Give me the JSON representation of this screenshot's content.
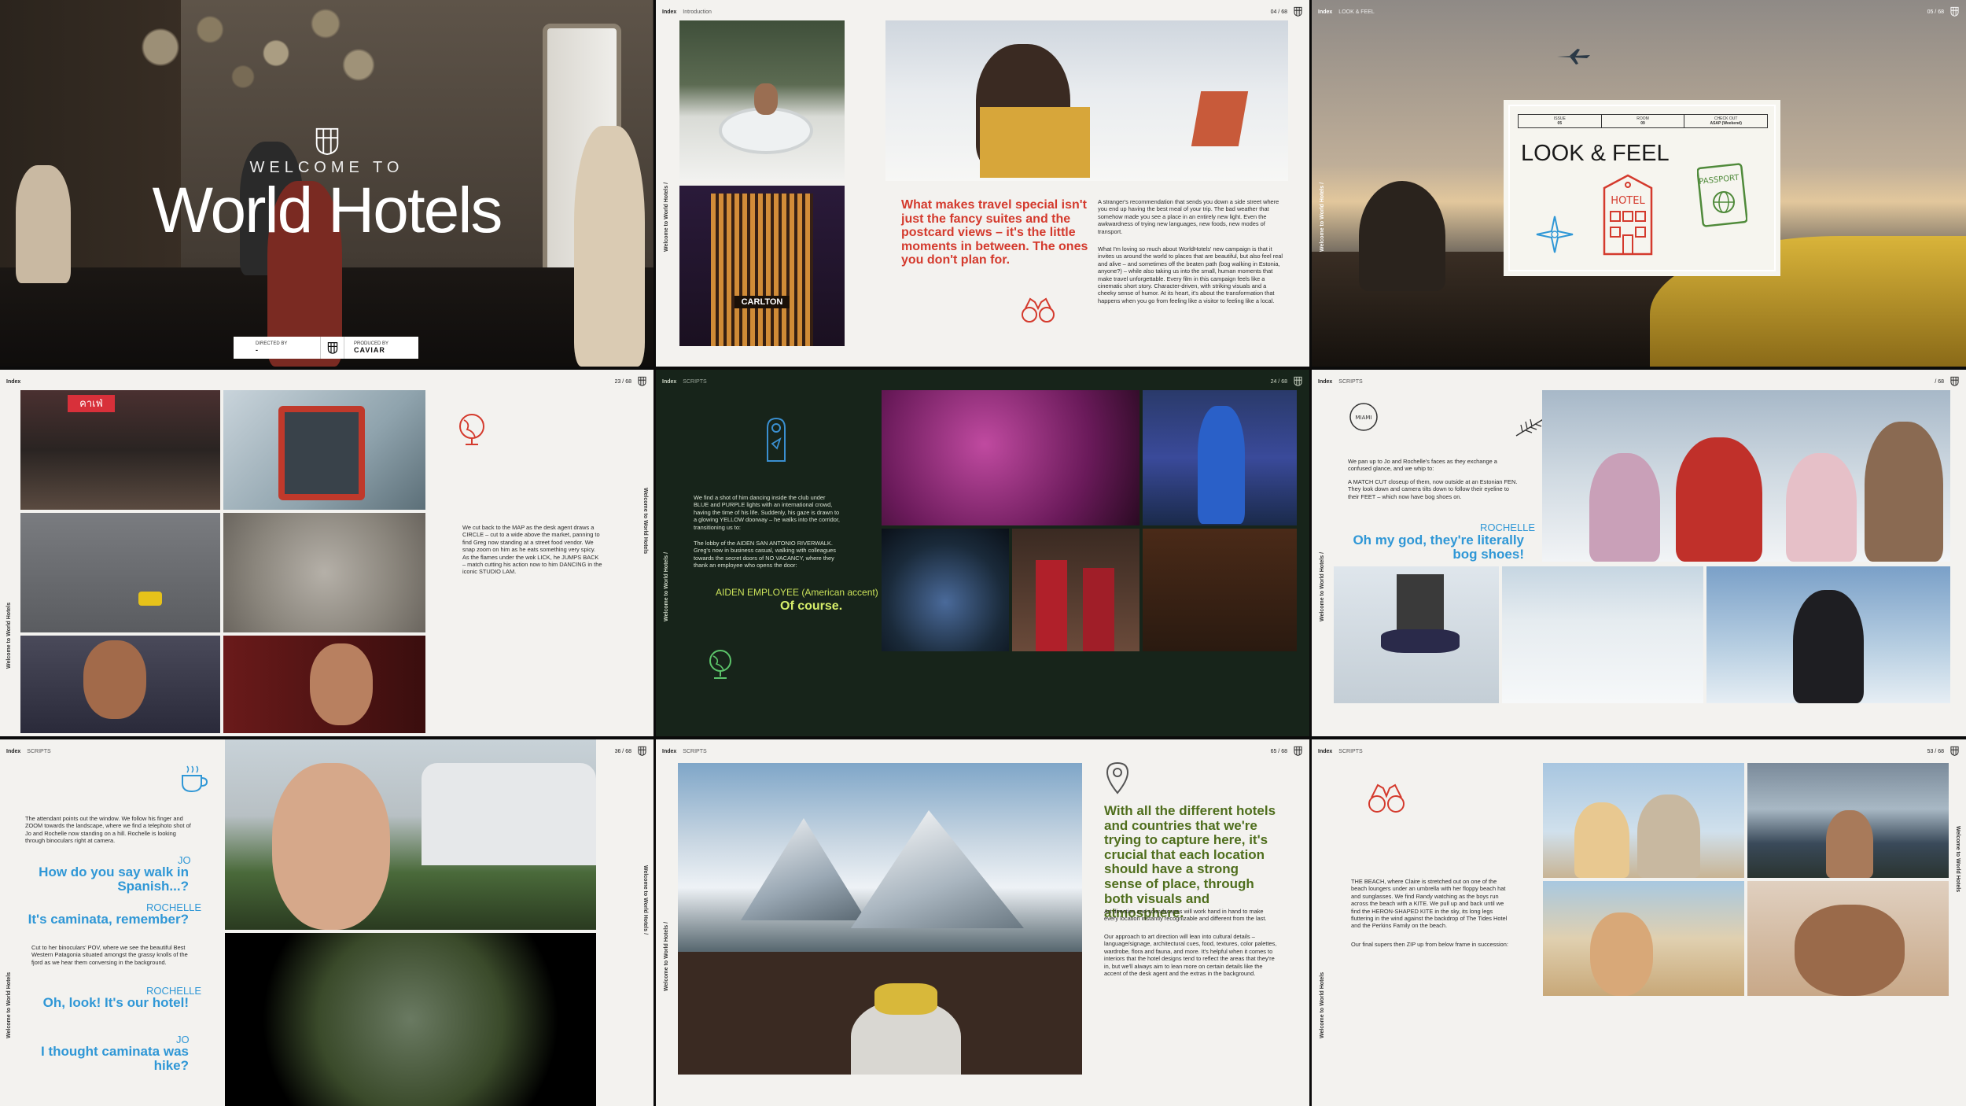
{
  "slides": {
    "s1": {
      "welcome": "WELCOME TO",
      "title": "World Hotels",
      "directed_label": "DIRECTED BY",
      "directed_value": "-",
      "produced_label": "PRODUCED BY",
      "produced_value": "CAVIAR"
    },
    "s2": {
      "index": "Index",
      "section": "Introduction",
      "page": "04 / 68",
      "side": "Welcome to World Hotels /",
      "sign": "CARLTON",
      "headline": "What makes travel special isn't just the fancy suites and the postcard views – it's the little moments in between. The ones you don't plan for.",
      "para1": "A stranger's recommendation that sends you down a side street where you end up having the best meal of your trip. The bad weather that somehow made you see a place in an entirely new light. Even the awkwardness of trying new languages, new foods, new modes of transport.",
      "para2": "What I'm loving so much about WorldHotels' new campaign is that it invites us around the world to places that are beautiful, but also feel real and alive – and sometimes off the beaten path (bog walking in Estonia, anyone?) – while also taking us into the small, human moments that make travel unforgettable. Every film in this campaign feels like a cinematic short story. Character-driven, with striking visuals and a cheeky sense of humor. At its heart, it's about the transformation that happens when you go from feeling like a visitor to feeling like a local."
    },
    "s3": {
      "index": "Index",
      "section": "LOOK & FEEL",
      "page": "05 / 68",
      "side": "Welcome to World Hotels /",
      "stamp_title": "LOOK & FEEL",
      "stamp_cells": [
        "05",
        "09",
        "ASAP (Weekend)"
      ],
      "stamp_cell_labels": [
        "ISSUE",
        "ROOM",
        "CHECK OUT"
      ],
      "hotel_label": "HOTEL",
      "passport_label": "PASSPORT"
    },
    "s4": {
      "index": "Index",
      "page": "23 / 68",
      "side_left": "Welcome to World Hotels",
      "side_right": "Welcome to World Hotels",
      "sign": "คาเฟ่",
      "body": "We cut back to the MAP as the desk agent draws a CIRCLE – cut to a wide above the market, panning to find Greg now standing at a street food vendor. We snap zoom on him as he eats something very spicy. As the flames under the wok LICK, he JUMPS BACK – match cutting his action now to him DANCING in the iconic STUDIO LAM."
    },
    "s5": {
      "index": "Index",
      "section": "SCRIPTS",
      "page": "24 / 68",
      "side": "Welcome to World Hotels /",
      "para1": "We find a shot of him dancing inside the club under BLUE and PURPLE lights with an international crowd, having the time of his life. Suddenly, his gaze is drawn to a glowing YELLOW doorway – he walks into the corridor, transitioning us to:",
      "para2": "The lobby of the AIDEN SAN ANTONIO RIVERWALK. Greg's now in business casual, walking with colleagues towards the secret doors of NO VACANCY, where they thank an employee who opens the door:",
      "speaker": "AIDEN EMPLOYEE (American accent)",
      "quote": "Of course."
    },
    "s6": {
      "index": "Index",
      "section": "SCRIPTS",
      "page": "/ 68",
      "side": "Welcome to World Hotels /",
      "badge": "MIAMI",
      "para1": "We pan up to Jo and Rochelle's faces as they exchange a confused glance, and we whip to:",
      "para2": "A MATCH CUT closeup of them, now outside at an Estonian FEN. They look down and camera tilts down to follow their eyeline to their FEET – which now have bog shoes on.",
      "speaker": "ROCHELLE",
      "quote": "Oh my god, they're literally bog shoes!"
    },
    "s7": {
      "index": "Index",
      "section": "SCRIPTS",
      "page": "36 / 68",
      "side_left": "Welcome to World Hotels",
      "side_right": "Welcome to World Hotels /",
      "para1": "The attendant points out the window. We follow his finger and ZOOM towards the landscape, where we find a telephoto shot of Jo and Rochelle now standing on a hill. Rochelle is looking through binoculars right at camera.",
      "jo1": "JO",
      "q1": "How do you say walk in Spanish...?",
      "ro": "ROCHELLE",
      "q2": "It's caminata, remember?",
      "para2": "Cut to her binoculars' POV, where we see the beautiful Best Western Patagonia situated amongst the grassy knolls of the fjord as we hear them conversing in the background.",
      "ro2": "ROCHELLE",
      "q3": "Oh, look! It's our hotel!",
      "jo2": "JO",
      "q4": "I thought caminata was hike?"
    },
    "s8": {
      "index": "Index",
      "section": "SCRIPTS",
      "page": "65 / 68",
      "side": "Welcome to World Hotels /",
      "headline": "With all the different hotels and countries that we're trying to capture here, it's crucial that each location should have a strong sense of place, through both visuals and atmosphere.",
      "para1": "Art direction and soundscapes will work hand in hand to make every location instantly recognizable and different from the last.",
      "para2": "Our approach to art direction will lean into cultural details – language/signage, architectural cues, food, textures, color palettes, wardrobe, flora and fauna, and more. It's helpful when it comes to interiors that the hotel designs tend to reflect the areas that they're in, but we'll always aim to lean more on certain details like the accent of the desk agent and the extras in the background."
    },
    "s9": {
      "index": "Index",
      "section": "SCRIPTS",
      "page": "53 / 68",
      "side_left": "Welcome to World Hotels",
      "side_right": "Welcome to World Hotels",
      "para1": "THE BEACH, where Claire is stretched out on one of the beach loungers under an umbrella with her floppy beach hat and sunglasses. We find Randy watching as the boys run across the beach with a KITE. We pull up and back until we find the HERON-SHAPED KITE in the sky, its long legs fluttering in the wind against the backdrop of The Tides Hotel and the Perkins Family on the beach.",
      "para2": "Our final supers then ZIP up from below frame in succession:"
    }
  },
  "colors": {
    "accent_red": "#d43a2d",
    "accent_blue": "#2f97d6",
    "accent_green": "#4f6e1d",
    "lime": "#d7ee6a"
  }
}
